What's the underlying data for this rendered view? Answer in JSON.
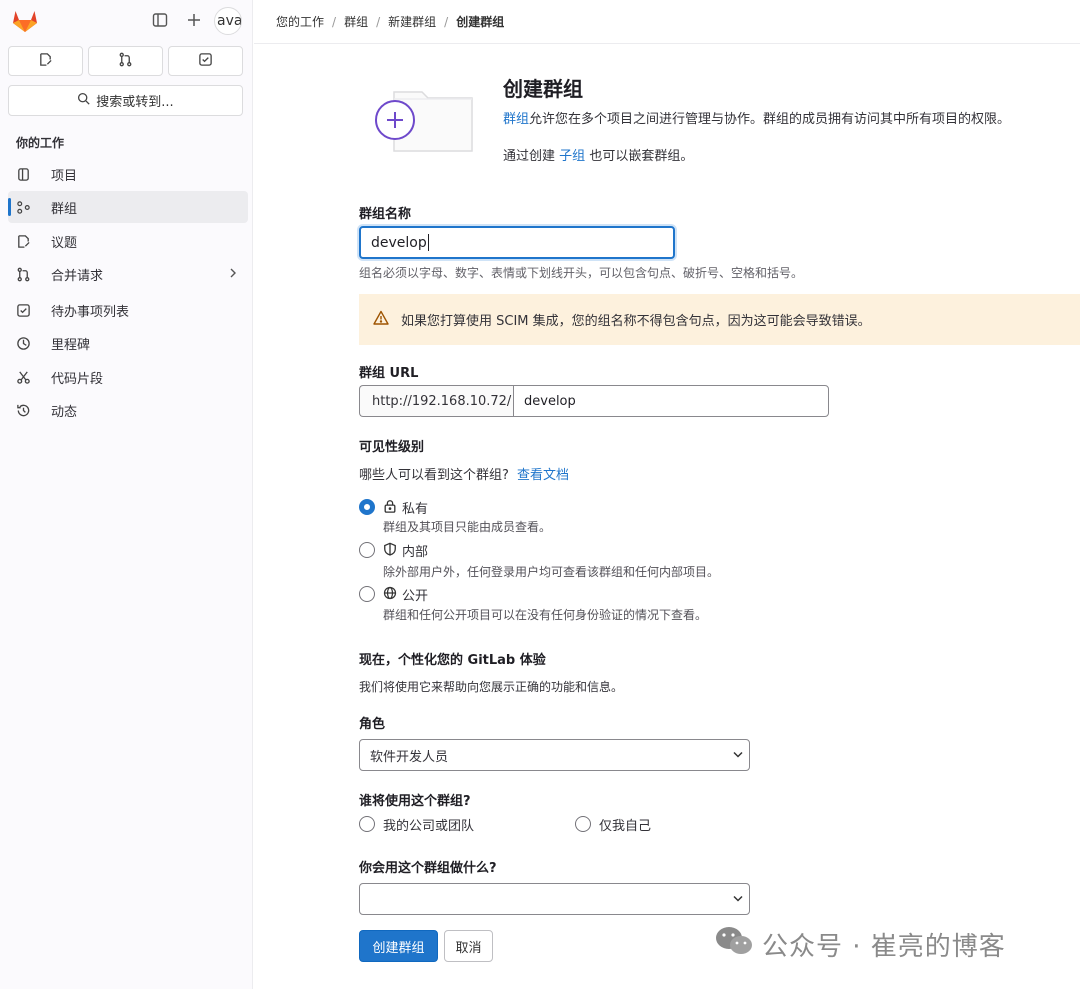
{
  "header": {
    "avatar_text": "ava",
    "search_label": "搜索或转到..."
  },
  "sidebar": {
    "section_title": "你的工作",
    "items": [
      {
        "label": "项目"
      },
      {
        "label": "群组"
      },
      {
        "label": "议题"
      },
      {
        "label": "合并请求"
      },
      {
        "label": "待办事项列表"
      },
      {
        "label": "里程碑"
      },
      {
        "label": "代码片段"
      },
      {
        "label": "动态"
      }
    ]
  },
  "breadcrumb": [
    "您的工作",
    "群组",
    "新建群组",
    "创建群组"
  ],
  "intro": {
    "title": "创建群组",
    "desc_link": "群组",
    "desc_rest": "允许您在多个项目之间进行管理与协作。群组的成员拥有访问其中所有项目的权限。",
    "sub_prefix": "通过创建",
    "sub_link": "子组",
    "sub_suffix": "也可以嵌套群组。"
  },
  "form": {
    "name_label": "群组名称",
    "name_value": "develop",
    "name_help": "组名必须以字母、数字、表情或下划线开头，可以包含句点、破折号、空格和括号。",
    "scim_warning": "如果您打算使用 SCIM 集成，您的组名称不得包含句点，因为这可能会导致错误。",
    "url_label": "群组 URL",
    "url_prefix": "http://192.168.10.72/",
    "url_value": "develop",
    "visibility_label": "可见性级别",
    "visibility_question": "哪些人可以看到这个群组?",
    "visibility_doc_link": "查看文档",
    "visibility_options": [
      {
        "label": "私有",
        "desc": "群组及其项目只能由成员查看。",
        "selected": true
      },
      {
        "label": "内部",
        "desc": "除外部用户外，任何登录用户均可查看该群组和任何内部项目。",
        "selected": false
      },
      {
        "label": "公开",
        "desc": "群组和任何公开项目可以在没有任何身份验证的情况下查看。",
        "selected": false
      }
    ],
    "personalize_title": "现在，个性化您的 GitLab 体验",
    "personalize_desc": "我们将使用它来帮助向您展示正确的功能和信息。",
    "role_label": "角色",
    "role_value": "软件开发人员",
    "who_label": "谁将使用这个群组?",
    "who_options": [
      "我的公司或团队",
      "仅我自己"
    ],
    "purpose_label": "你会用这个群组做什么?",
    "purpose_value": "",
    "create_button": "创建群组",
    "cancel_button": "取消"
  },
  "watermark": "公众号 · 崔亮的博客",
  "colors": {
    "accent": "#1f75cb",
    "warning_bg": "#fdf1dd",
    "brand_orange": "#e24329"
  }
}
